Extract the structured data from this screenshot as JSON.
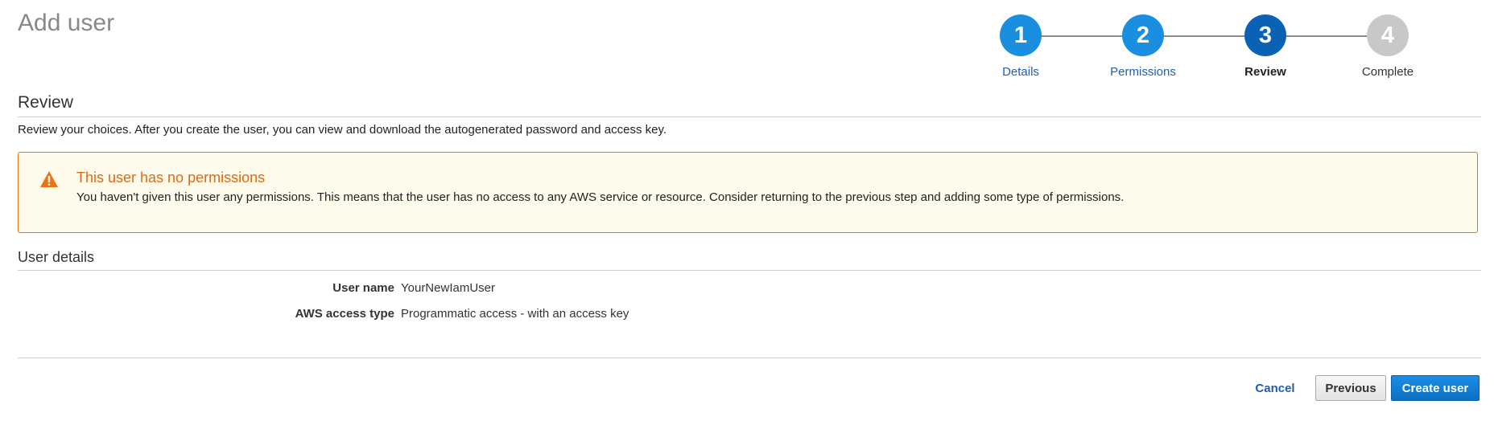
{
  "page": {
    "title": "Add user"
  },
  "wizard": {
    "steps": [
      {
        "number": "1",
        "label": "Details",
        "state": "link"
      },
      {
        "number": "2",
        "label": "Permissions",
        "state": "link"
      },
      {
        "number": "3",
        "label": "Review",
        "state": "active"
      },
      {
        "number": "4",
        "label": "Complete",
        "state": "pending"
      }
    ]
  },
  "review": {
    "heading": "Review",
    "intro": "Review your choices. After you create the user, you can view and download the autogenerated password and access key."
  },
  "alert": {
    "icon": "warning-triangle-icon",
    "title": "This user has no permissions",
    "body": "You haven't given this user any permissions. This means that the user has no access to any AWS service or resource. Consider returning to the previous step and adding some type of permissions."
  },
  "user_details": {
    "heading": "User details",
    "rows": [
      {
        "key": "User name",
        "value": "YourNewIamUser"
      },
      {
        "key": "AWS access type",
        "value": "Programmatic access - with an access key"
      }
    ]
  },
  "actions": {
    "cancel": "Cancel",
    "previous": "Previous",
    "create": "Create user"
  },
  "colors": {
    "accent": "#1a8fe0",
    "active_step": "#0a62b5",
    "warning": "#ec7211",
    "warning_bg": "#fefaec"
  }
}
